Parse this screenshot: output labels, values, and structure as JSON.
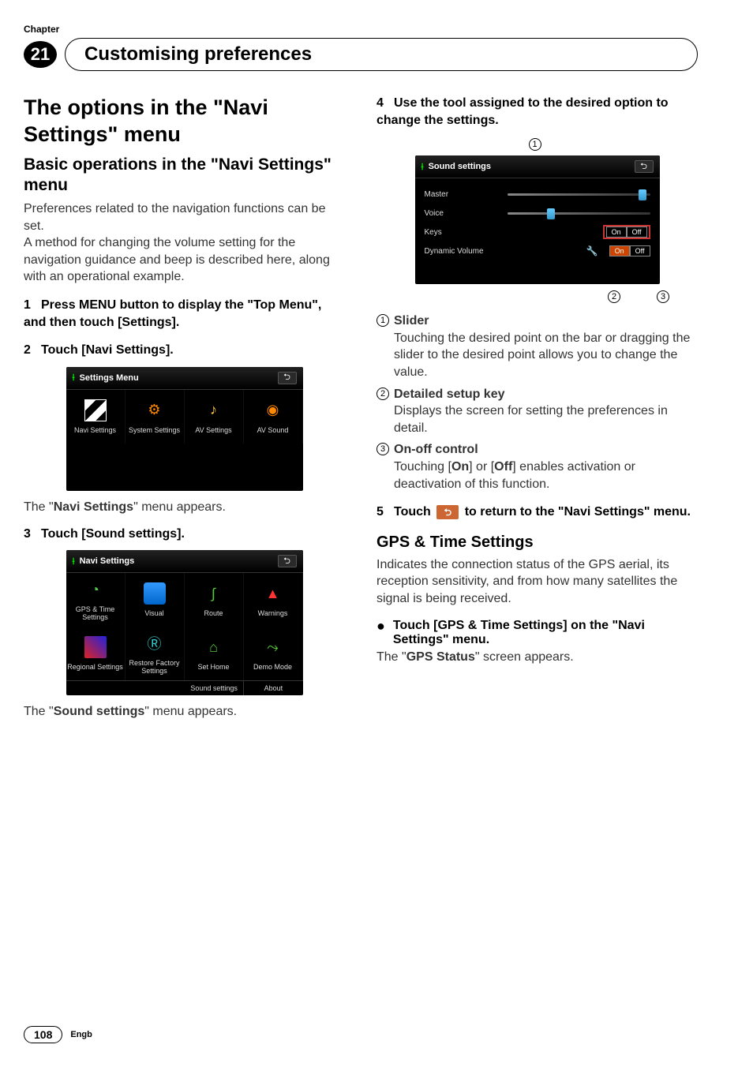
{
  "header": {
    "chapter_label": "Chapter",
    "chapter_number": "21",
    "title": "Customising preferences"
  },
  "left": {
    "h1_a": "The options in the \"",
    "h1_b": "Navi Settings",
    "h1_c": "\" menu",
    "h2_a": "Basic operations in the \"",
    "h2_b": "Navi Settings",
    "h2_c": "\" menu",
    "intro": "Preferences related to the navigation functions can be set.\nA method for changing the volume setting for the navigation guidance and beep is described here, along with an operational example.",
    "step1_num": "1",
    "step1": "Press MENU button to display the \"Top Menu\", and then touch [Settings].",
    "step2_num": "2",
    "step2": "Touch [Navi Settings].",
    "shot1": {
      "title": "Settings Menu",
      "items": [
        "Navi Settings",
        "System Settings",
        "AV Settings",
        "AV Sound"
      ]
    },
    "after1_a": "The \"",
    "after1_b": "Navi Settings",
    "after1_c": "\" menu appears.",
    "step3_num": "3",
    "step3": "Touch [Sound settings].",
    "shot2": {
      "title": "Navi Settings",
      "row1": [
        "GPS & Time Settings",
        "Visual",
        "Route",
        "Warnings"
      ],
      "row2": [
        "Regional Settings",
        "Restore Factory Settings",
        "Set Home",
        "Demo Mode"
      ],
      "bottom": [
        "Sound settings",
        "About"
      ]
    },
    "after2_a": "The \"",
    "after2_b": "Sound settings",
    "after2_c": "\" menu appears."
  },
  "right": {
    "step4_num": "4",
    "step4": "Use the tool assigned to the desired option to change the settings.",
    "callout_top": "1",
    "shot3": {
      "title": "Sound settings",
      "rows": [
        {
          "label": "Master",
          "thumb": 92
        },
        {
          "label": "Voice",
          "thumb": 28
        },
        {
          "label": "Keys",
          "on": "On",
          "off": "Off",
          "highlight": true
        },
        {
          "label": "Dynamic Volume",
          "on": "On",
          "off": "Off",
          "tool": true
        }
      ]
    },
    "callout_b2": "2",
    "callout_b3": "3",
    "list": [
      {
        "num": "1",
        "head": "Slider",
        "body": "Touching the desired point on the bar or dragging the slider to the desired point allows you to change the value."
      },
      {
        "num": "2",
        "head": "Detailed setup key",
        "body": "Displays the screen for setting the preferences in detail."
      },
      {
        "num": "3",
        "head": "On-off control",
        "body_a": "Touching [",
        "body_b": "On",
        "body_c": "] or [",
        "body_d": "Off",
        "body_e": "] enables activation or deactivation of this function."
      }
    ],
    "step5_num": "5",
    "step5_a": "Touch ",
    "step5_b": " to return to the \"Navi Settings\" menu.",
    "h3": "GPS & Time Settings",
    "gps_body": "Indicates the connection status of the GPS aerial, its reception sensitivity, and from how many satellites the signal is being received.",
    "bullet": "Touch [GPS & Time Settings] on the \"Navi Settings\" menu.",
    "gps_after_a": "The \"",
    "gps_after_b": "GPS Status",
    "gps_after_c": "\" screen appears."
  },
  "footer": {
    "page": "108",
    "lang": "Engb"
  }
}
